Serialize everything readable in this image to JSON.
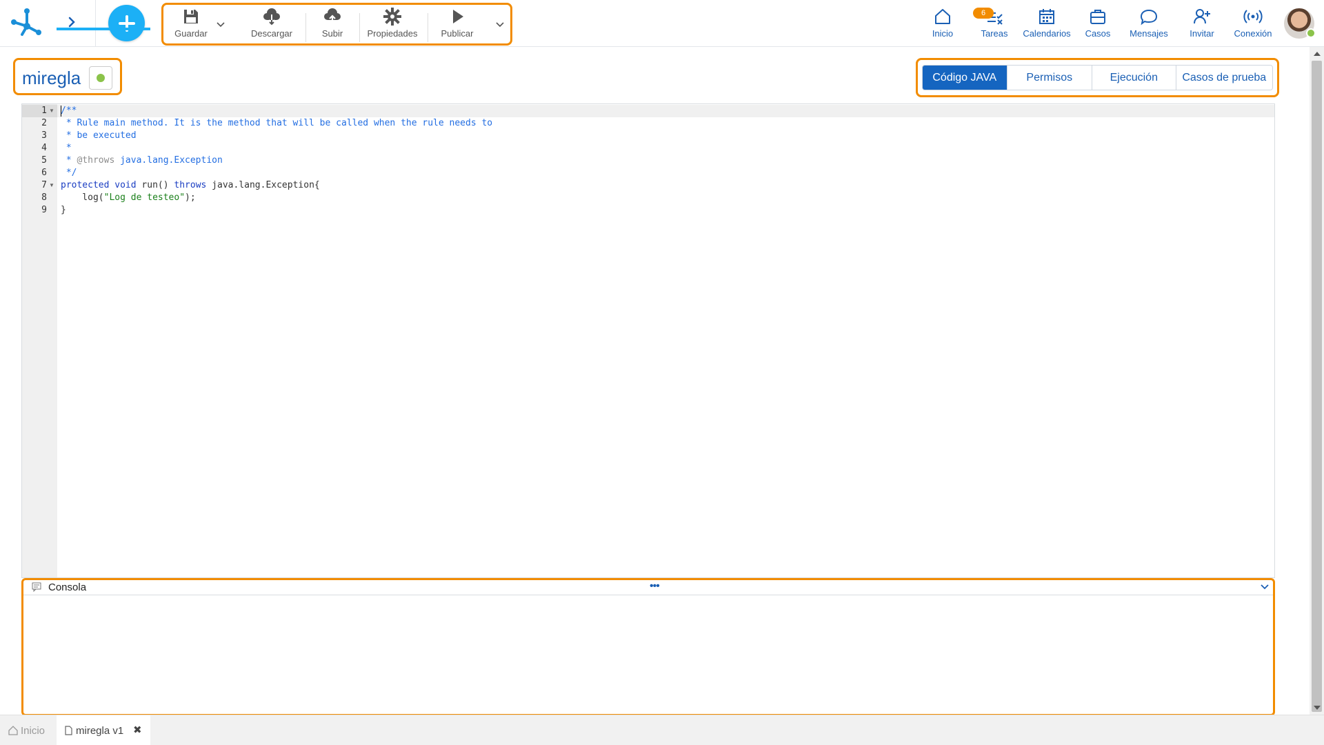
{
  "toolbar": {
    "save_label": "Guardar",
    "download_label": "Descargar",
    "upload_label": "Subir",
    "properties_label": "Propiedades",
    "publish_label": "Publicar"
  },
  "nav": {
    "home_label": "Inicio",
    "tasks_label": "Tareas",
    "tasks_badge": "6",
    "calendars_label": "Calendarios",
    "cases_label": "Casos",
    "messages_label": "Mensajes",
    "invite_label": "Invitar",
    "connection_label": "Conexión"
  },
  "rule": {
    "name": "miregla",
    "status_color": "#8bc34a"
  },
  "tabs": [
    {
      "label": "Código JAVA",
      "active": true
    },
    {
      "label": "Permisos",
      "active": false
    },
    {
      "label": "Ejecución",
      "active": false
    },
    {
      "label": "Casos de prueba",
      "active": false
    }
  ],
  "editor": {
    "line_numbers": [
      "1",
      "2",
      "3",
      "4",
      "5",
      "6",
      "7",
      "8",
      "9"
    ],
    "lines": [
      "/**",
      " * Rule main method. It is the method that will be called when the rule needs to",
      " * be executed",
      " *",
      " * @throws java.lang.Exception",
      " */",
      "protected void run() throws java.lang.Exception{",
      "    log(\"Log de testeo\");",
      "}"
    ]
  },
  "console": {
    "title": "Consola",
    "dots": "•••"
  },
  "bottom_tabs": {
    "home_label": "Inicio",
    "rule_label": "miregla v1",
    "close_glyph": "✖"
  },
  "colors": {
    "accent": "#1cb0f6",
    "highlight": "#f28c00",
    "primary": "#1565c0"
  }
}
